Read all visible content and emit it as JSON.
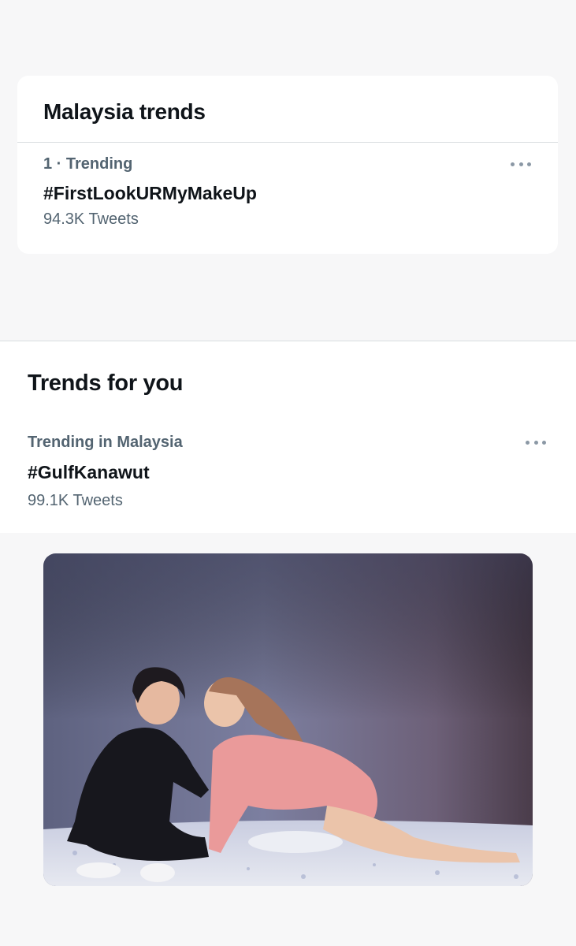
{
  "malaysia_trends": {
    "title": "Malaysia trends",
    "item": {
      "meta": "1 · Trending",
      "hashtag": "#FirstLookURMyMakeUp",
      "count": "94.3K Tweets"
    }
  },
  "trends_for_you": {
    "title": "Trends for you",
    "item": {
      "meta": "Trending in Malaysia",
      "hashtag": "#GulfKanawut",
      "count": "99.1K Tweets"
    }
  },
  "icons": {
    "more": "more-horizontal-icon"
  },
  "colors": {
    "primary_text": "#0f1419",
    "secondary_text": "#536471",
    "divider": "#d9dde0",
    "background": "#f7f7f8"
  }
}
